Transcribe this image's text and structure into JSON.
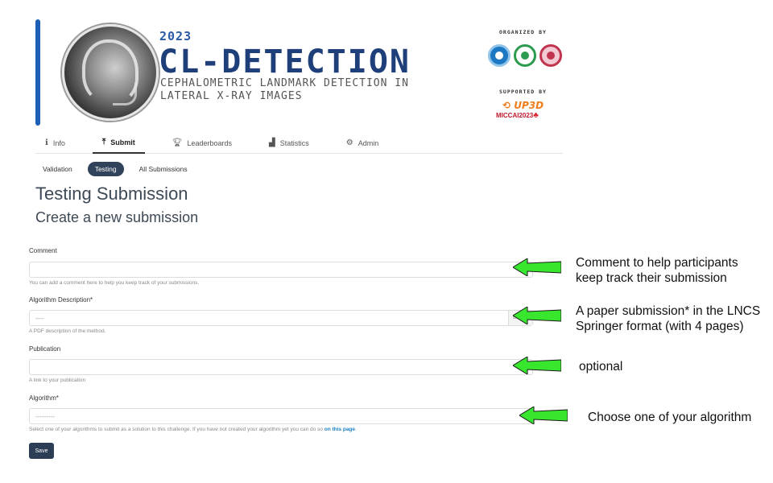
{
  "banner": {
    "year": "2023",
    "title": "CL-DETECTION",
    "subtitle": "CEPHALOMETRIC LANDMARK DETECTION IN LATERAL X-RAY IMAGES",
    "organized_by": "ORGANIZED BY",
    "supported_by": "SUPPORTED BY",
    "sponsor_1": "UP3D",
    "sponsor_2": "MICCAI2023"
  },
  "tabs": [
    {
      "label": "Info",
      "icon": "info-icon"
    },
    {
      "label": "Submit",
      "icon": "upload-icon",
      "active": true
    },
    {
      "label": "Leaderboards",
      "icon": "trophy-icon"
    },
    {
      "label": "Statistics",
      "icon": "chart-icon"
    },
    {
      "label": "Admin",
      "icon": "gear-icon"
    }
  ],
  "subtabs": [
    {
      "label": "Validation"
    },
    {
      "label": "Testing",
      "active": true
    },
    {
      "label": "All Submissions"
    }
  ],
  "page": {
    "title": "Testing Submission",
    "subtitle": "Create a new submission"
  },
  "form": {
    "comment": {
      "label": "Comment",
      "value": "",
      "help": "You can add a comment here to help you keep track of your submissions."
    },
    "algorithm_description": {
      "label": "Algorithm Description*",
      "value": "----",
      "browse": "Br",
      "help": "A PDF description of the method."
    },
    "publication": {
      "label": "Publication",
      "value": "",
      "help": "A link to your publication"
    },
    "algorithm": {
      "label": "Algorithm*",
      "value": "---------",
      "help_prefix": "Select one of your algorithms to submit as a solution to this challenge. If you have not created your algorithm yet you can do so ",
      "help_link": "on this page",
      "help_suffix": "."
    },
    "save_label": "Save"
  },
  "annotations": {
    "note_1": [
      "Comment to help participants",
      "keep track their submission"
    ],
    "note_2": [
      "A paper submission* in the LNCS",
      "Springer format (with 4 pages)"
    ],
    "note_3": [
      "optional"
    ],
    "note_4": [
      "Choose one of your algorithm"
    ],
    "arrow_color": "#39e62e"
  },
  "colors": {
    "accent": "#1d5fb5",
    "title_blue": "#1f3f7a",
    "active_pill": "#31435a",
    "save_button": "#2c3e55",
    "link": "#1a7fc4"
  }
}
